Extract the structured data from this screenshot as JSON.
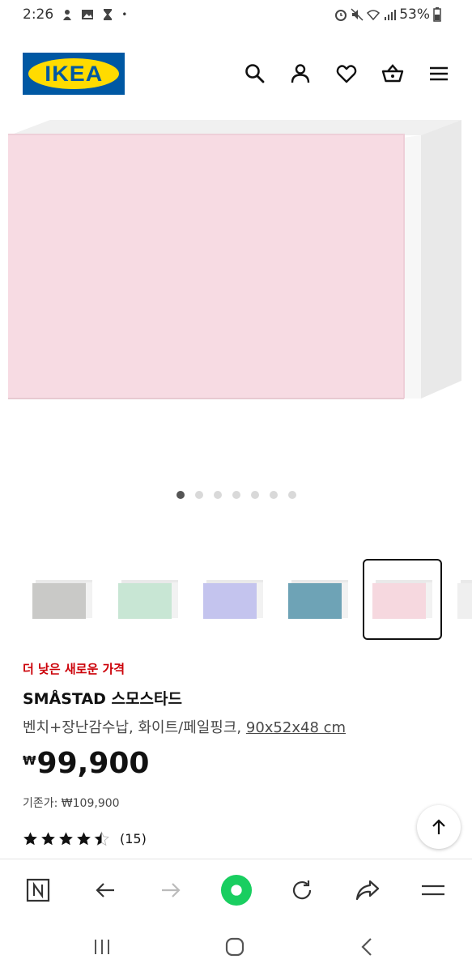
{
  "status_bar": {
    "time": "2:26",
    "battery": "53%"
  },
  "header": {
    "logo_text": "IKEA",
    "icons": [
      "search-icon",
      "user-icon",
      "heart-icon",
      "cart-icon",
      "menu-icon"
    ]
  },
  "gallery": {
    "dot_count": 7,
    "active_dot": 0,
    "thumbnails": [
      {
        "color": "grey",
        "front": "#c9c9c7"
      },
      {
        "color": "mint",
        "front": "#c8e6d4"
      },
      {
        "color": "lilac",
        "front": "#c4c4ee"
      },
      {
        "color": "blue",
        "front": "#6ea3b6"
      },
      {
        "color": "pink",
        "front": "#f6d8df",
        "selected": true
      }
    ]
  },
  "product": {
    "promo_label": "더 낮은 새로운 가격",
    "name": "SMÅSTAD 스모스타드",
    "description": "벤치+장난감수납, 화이트/페일핑크, ",
    "size": "90x52x48 cm",
    "currency": "₩",
    "price": "99,900",
    "regular_price": "기존가: ₩109,900",
    "rating_value": 4.5,
    "review_count": "(15)"
  },
  "colors": {
    "ikea_blue": "#0058a3",
    "ikea_yellow": "#ffdb00",
    "promo_red": "#cc0008",
    "browser_green": "#19ce60"
  },
  "browser_bar": {
    "icons": [
      "n-tab-icon",
      "back-arrow-icon",
      "forward-arrow-icon",
      "home-icon",
      "reload-icon",
      "share-icon",
      "menu-icon"
    ]
  },
  "nav_bar": {
    "icons": [
      "recent-apps-icon",
      "home-icon",
      "back-icon"
    ]
  }
}
